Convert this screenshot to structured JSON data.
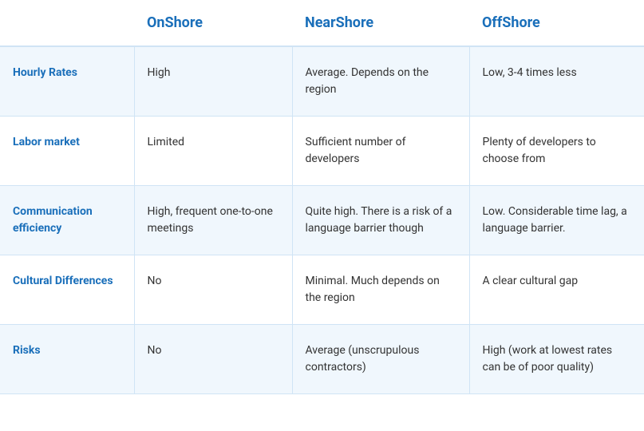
{
  "table": {
    "headers": {
      "label": "",
      "onshore": "OnShore",
      "nearshore": "NearShore",
      "offshore": "OffShore"
    },
    "rows": [
      {
        "label": "Hourly Rates",
        "onshore": "High",
        "nearshore": "Average. Depends on the region",
        "offshore": "Low, 3-4 times less"
      },
      {
        "label": "Labor market",
        "onshore": "Limited",
        "nearshore": "Sufficient number of developers",
        "offshore": "Plenty of developers to choose from"
      },
      {
        "label": "Communication efficiency",
        "onshore": "High, frequent one-to-one meetings",
        "nearshore": "Quite high. There is a risk of a language barrier though",
        "offshore": "Low. Considerable time lag, a language barrier."
      },
      {
        "label": "Cultural Differences",
        "onshore": "No",
        "nearshore": "Minimal. Much depends on the region",
        "offshore": "A clear cultural gap"
      },
      {
        "label": "Risks",
        "onshore": "No",
        "nearshore": "Average (unscrupulous contractors)",
        "offshore": "High (work at lowest rates can be of poor quality)"
      }
    ]
  }
}
